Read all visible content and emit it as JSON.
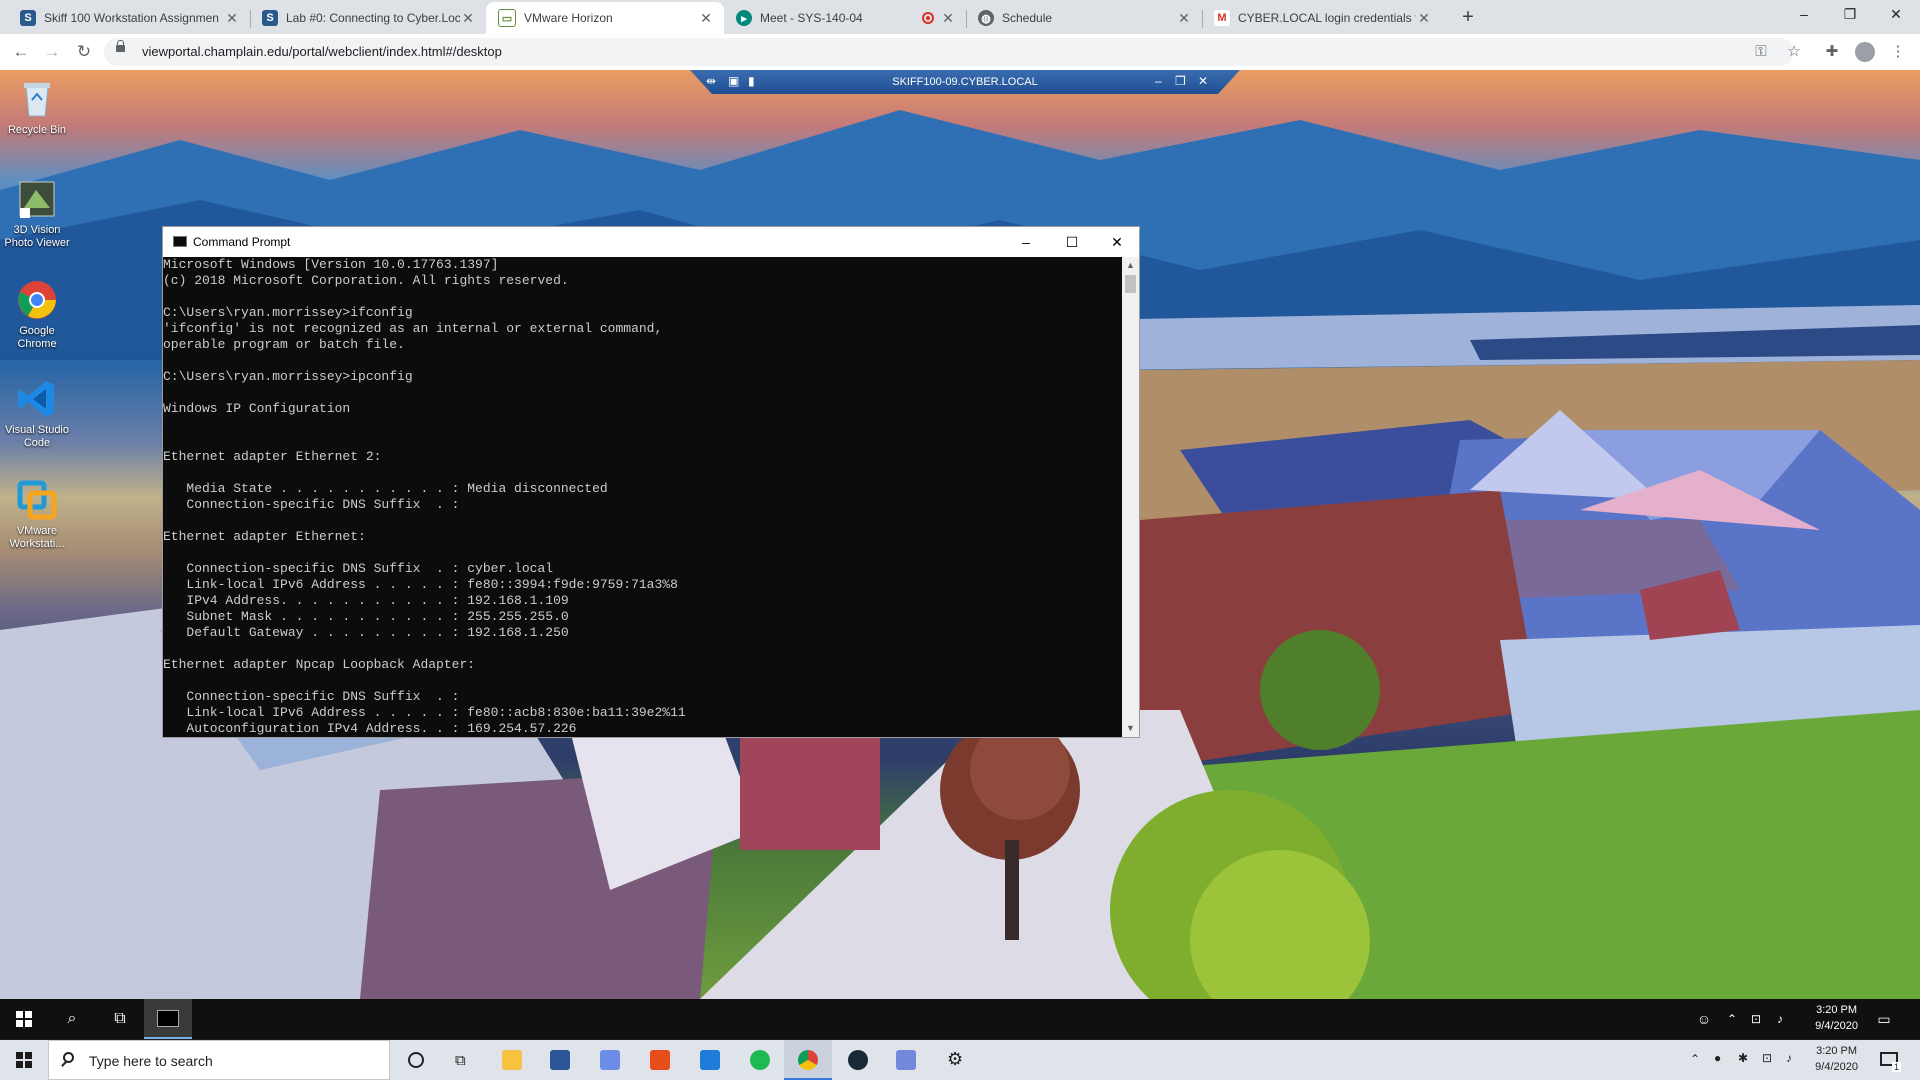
{
  "browser": {
    "tabs": [
      {
        "title": "Skiff 100 Workstation Assignmen",
        "icon": "skiff-icon",
        "active": false
      },
      {
        "title": "Lab #0: Connecting to Cyber.Loc",
        "icon": "skiff-icon",
        "active": false
      },
      {
        "title": "VMware Horizon",
        "icon": "vmware-horizon-icon",
        "active": true
      },
      {
        "title": "Meet - SYS-140-04",
        "icon": "google-meet-icon",
        "active": false,
        "recording": true
      },
      {
        "title": "Schedule",
        "icon": "globe-icon",
        "active": false
      },
      {
        "title": "CYBER.LOCAL login credentials fo",
        "icon": "gmail-icon",
        "active": false
      }
    ],
    "url": "viewportal.champlain.edu/portal/webclient/index.html#/desktop"
  },
  "horizon_bar": {
    "title": "SKIFF100-09.CYBER.LOCAL"
  },
  "desktop_icons": [
    {
      "label": "Recycle Bin",
      "icon": "recycle-bin-icon"
    },
    {
      "label": "3D Vision Photo Viewer",
      "icon": "3d-vision-icon"
    },
    {
      "label": "Google Chrome",
      "icon": "chrome-icon"
    },
    {
      "label": "Visual Studio Code",
      "icon": "vscode-icon"
    },
    {
      "label": "VMware Workstati...",
      "icon": "vmware-workstation-icon"
    }
  ],
  "cmd": {
    "title": "Command Prompt",
    "lines": "Microsoft Windows [Version 10.0.17763.1397]\n(c) 2018 Microsoft Corporation. All rights reserved.\n\nC:\\Users\\ryan.morrissey>ifconfig\n'ifconfig' is not recognized as an internal or external command,\noperable program or batch file.\n\nC:\\Users\\ryan.morrissey>ipconfig\n\nWindows IP Configuration\n\n\nEthernet adapter Ethernet 2:\n\n   Media State . . . . . . . . . . . : Media disconnected\n   Connection-specific DNS Suffix  . :\n\nEthernet adapter Ethernet:\n\n   Connection-specific DNS Suffix  . : cyber.local\n   Link-local IPv6 Address . . . . . : fe80::3994:f9de:9759:71a3%8\n   IPv4 Address. . . . . . . . . . . : 192.168.1.109\n   Subnet Mask . . . . . . . . . . . : 255.255.255.0\n   Default Gateway . . . . . . . . . : 192.168.1.250\n\nEthernet adapter Npcap Loopback Adapter:\n\n   Connection-specific DNS Suffix  . :\n   Link-local IPv6 Address . . . . . : fe80::acb8:830e:ba11:39e2%11\n   Autoconfiguration IPv4 Address. . : 169.254.57.226"
  },
  "remote_taskbar": {
    "time": "3:20 PM",
    "date": "9/4/2020"
  },
  "host_taskbar": {
    "search_placeholder": "Type here to search",
    "time": "3:20 PM",
    "date": "9/4/2020",
    "notification_count": "1"
  }
}
